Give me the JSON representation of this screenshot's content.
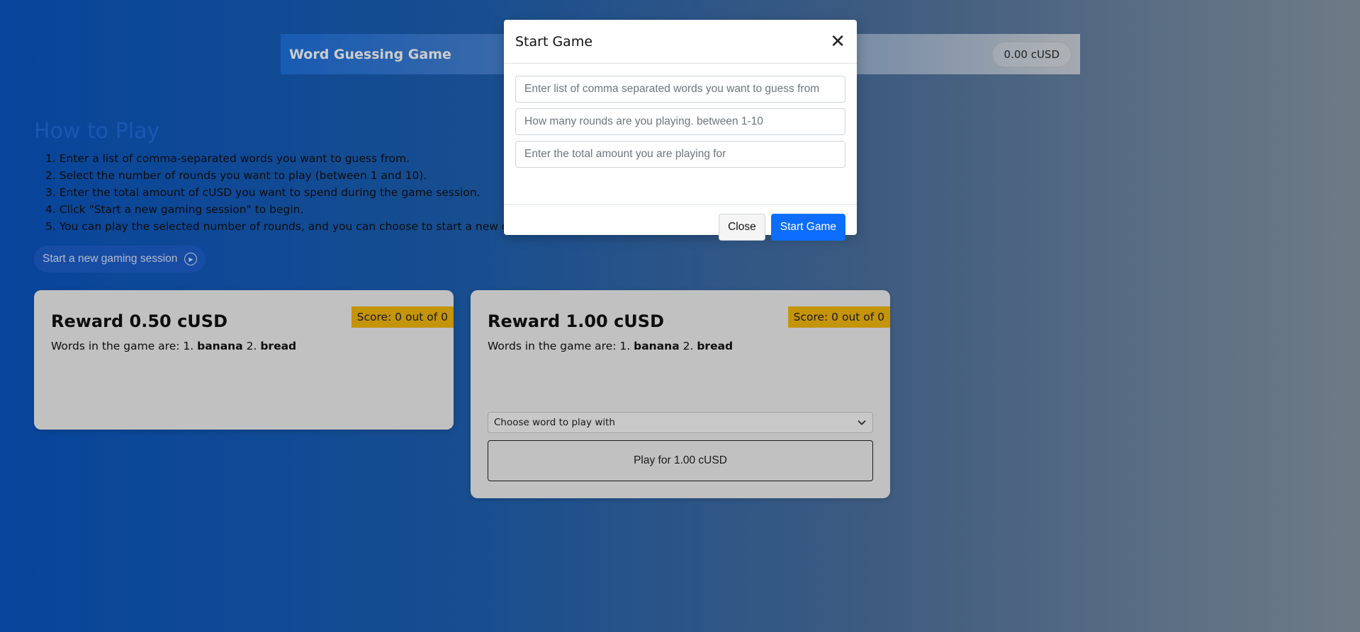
{
  "header": {
    "title": "Word Guessing Game",
    "balance": "0.00 cUSD"
  },
  "how_to_play": {
    "title": "How to Play",
    "steps": [
      "1. Enter a list of comma-separated words you want to guess from.",
      "2. Select the number of rounds you want to play (between 1 and 10).",
      "3. Enter the total amount of cUSD you want to spend during the game session.",
      "4. Click \"Start a new gaming session\" to begin.",
      "5. You can play the selected number of rounds, and you can choose to start a new game                                                                                       us round."
    ],
    "start_button": "Start a new gaming session"
  },
  "cards": [
    {
      "reward": "Reward 0.50 cUSD",
      "score": "Score: 0 out of 0",
      "words_prefix": "Words in the game are: 1.",
      "word1": "banana",
      "sep": "2.",
      "word2": "bread"
    },
    {
      "reward": "Reward 1.00 cUSD",
      "score": "Score: 0 out of 0",
      "words_prefix": "Words in the game are: 1.",
      "word1": "banana",
      "sep": "2.",
      "word2": "bread",
      "select_value": "Choose word to play with",
      "play_label": "Play for 1.00 cUSD"
    }
  ],
  "modal": {
    "title": "Start Game",
    "inputs": [
      {
        "placeholder": "Enter list of comma separated words you want to guess from",
        "value": ""
      },
      {
        "placeholder": "How many rounds are you playing. between 1-10",
        "value": ""
      },
      {
        "placeholder": "Enter the total amount you are playing for",
        "value": ""
      }
    ],
    "close_label": "Close",
    "start_label": "Start Game"
  },
  "colors": {
    "accent": "#0d6efd",
    "badge": "#f5b90d"
  }
}
